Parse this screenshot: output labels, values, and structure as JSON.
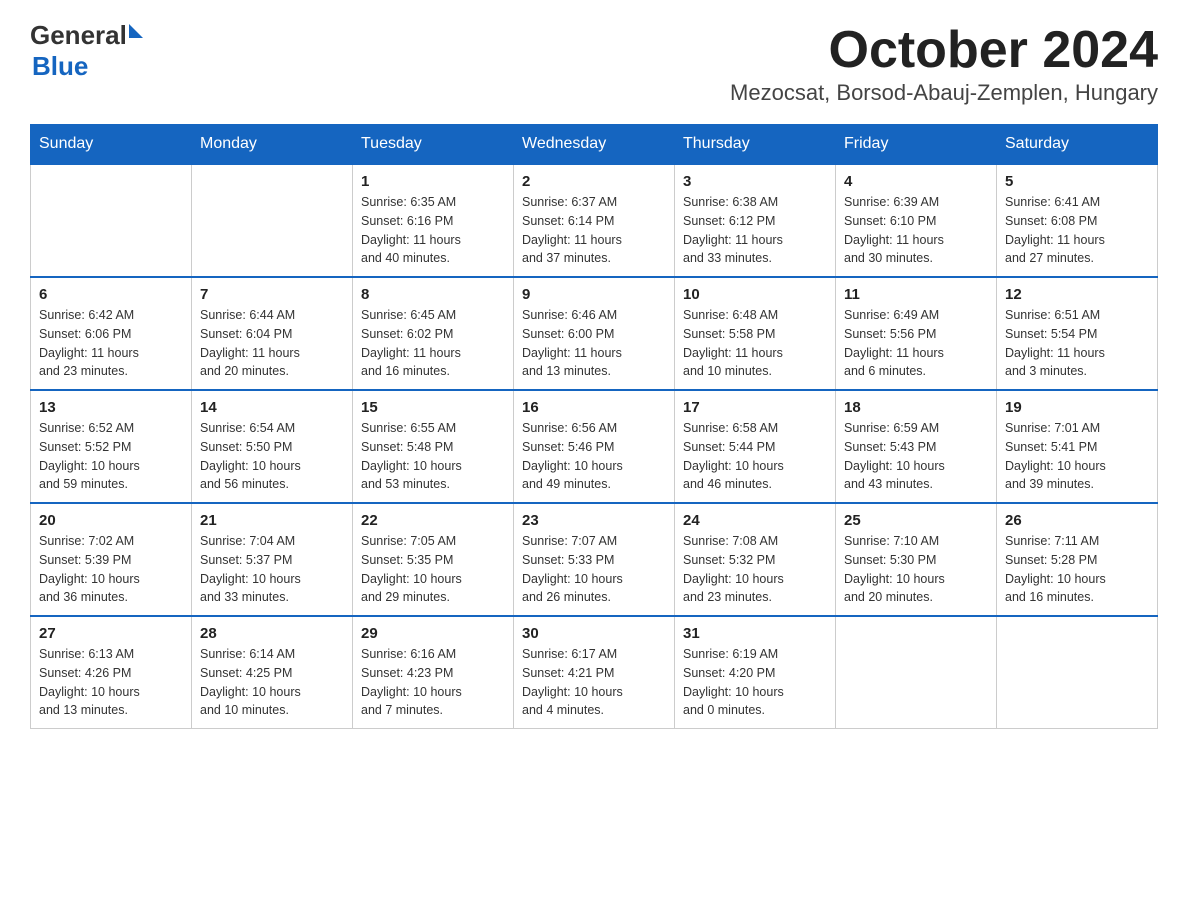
{
  "logo": {
    "general": "General",
    "blue": "Blue"
  },
  "title": "October 2024",
  "location": "Mezocsat, Borsod-Abauj-Zemplen, Hungary",
  "weekdays": [
    "Sunday",
    "Monday",
    "Tuesday",
    "Wednesday",
    "Thursday",
    "Friday",
    "Saturday"
  ],
  "weeks": [
    [
      {
        "day": "",
        "info": ""
      },
      {
        "day": "",
        "info": ""
      },
      {
        "day": "1",
        "info": "Sunrise: 6:35 AM\nSunset: 6:16 PM\nDaylight: 11 hours\nand 40 minutes."
      },
      {
        "day": "2",
        "info": "Sunrise: 6:37 AM\nSunset: 6:14 PM\nDaylight: 11 hours\nand 37 minutes."
      },
      {
        "day": "3",
        "info": "Sunrise: 6:38 AM\nSunset: 6:12 PM\nDaylight: 11 hours\nand 33 minutes."
      },
      {
        "day": "4",
        "info": "Sunrise: 6:39 AM\nSunset: 6:10 PM\nDaylight: 11 hours\nand 30 minutes."
      },
      {
        "day": "5",
        "info": "Sunrise: 6:41 AM\nSunset: 6:08 PM\nDaylight: 11 hours\nand 27 minutes."
      }
    ],
    [
      {
        "day": "6",
        "info": "Sunrise: 6:42 AM\nSunset: 6:06 PM\nDaylight: 11 hours\nand 23 minutes."
      },
      {
        "day": "7",
        "info": "Sunrise: 6:44 AM\nSunset: 6:04 PM\nDaylight: 11 hours\nand 20 minutes."
      },
      {
        "day": "8",
        "info": "Sunrise: 6:45 AM\nSunset: 6:02 PM\nDaylight: 11 hours\nand 16 minutes."
      },
      {
        "day": "9",
        "info": "Sunrise: 6:46 AM\nSunset: 6:00 PM\nDaylight: 11 hours\nand 13 minutes."
      },
      {
        "day": "10",
        "info": "Sunrise: 6:48 AM\nSunset: 5:58 PM\nDaylight: 11 hours\nand 10 minutes."
      },
      {
        "day": "11",
        "info": "Sunrise: 6:49 AM\nSunset: 5:56 PM\nDaylight: 11 hours\nand 6 minutes."
      },
      {
        "day": "12",
        "info": "Sunrise: 6:51 AM\nSunset: 5:54 PM\nDaylight: 11 hours\nand 3 minutes."
      }
    ],
    [
      {
        "day": "13",
        "info": "Sunrise: 6:52 AM\nSunset: 5:52 PM\nDaylight: 10 hours\nand 59 minutes."
      },
      {
        "day": "14",
        "info": "Sunrise: 6:54 AM\nSunset: 5:50 PM\nDaylight: 10 hours\nand 56 minutes."
      },
      {
        "day": "15",
        "info": "Sunrise: 6:55 AM\nSunset: 5:48 PM\nDaylight: 10 hours\nand 53 minutes."
      },
      {
        "day": "16",
        "info": "Sunrise: 6:56 AM\nSunset: 5:46 PM\nDaylight: 10 hours\nand 49 minutes."
      },
      {
        "day": "17",
        "info": "Sunrise: 6:58 AM\nSunset: 5:44 PM\nDaylight: 10 hours\nand 46 minutes."
      },
      {
        "day": "18",
        "info": "Sunrise: 6:59 AM\nSunset: 5:43 PM\nDaylight: 10 hours\nand 43 minutes."
      },
      {
        "day": "19",
        "info": "Sunrise: 7:01 AM\nSunset: 5:41 PM\nDaylight: 10 hours\nand 39 minutes."
      }
    ],
    [
      {
        "day": "20",
        "info": "Sunrise: 7:02 AM\nSunset: 5:39 PM\nDaylight: 10 hours\nand 36 minutes."
      },
      {
        "day": "21",
        "info": "Sunrise: 7:04 AM\nSunset: 5:37 PM\nDaylight: 10 hours\nand 33 minutes."
      },
      {
        "day": "22",
        "info": "Sunrise: 7:05 AM\nSunset: 5:35 PM\nDaylight: 10 hours\nand 29 minutes."
      },
      {
        "day": "23",
        "info": "Sunrise: 7:07 AM\nSunset: 5:33 PM\nDaylight: 10 hours\nand 26 minutes."
      },
      {
        "day": "24",
        "info": "Sunrise: 7:08 AM\nSunset: 5:32 PM\nDaylight: 10 hours\nand 23 minutes."
      },
      {
        "day": "25",
        "info": "Sunrise: 7:10 AM\nSunset: 5:30 PM\nDaylight: 10 hours\nand 20 minutes."
      },
      {
        "day": "26",
        "info": "Sunrise: 7:11 AM\nSunset: 5:28 PM\nDaylight: 10 hours\nand 16 minutes."
      }
    ],
    [
      {
        "day": "27",
        "info": "Sunrise: 6:13 AM\nSunset: 4:26 PM\nDaylight: 10 hours\nand 13 minutes."
      },
      {
        "day": "28",
        "info": "Sunrise: 6:14 AM\nSunset: 4:25 PM\nDaylight: 10 hours\nand 10 minutes."
      },
      {
        "day": "29",
        "info": "Sunrise: 6:16 AM\nSunset: 4:23 PM\nDaylight: 10 hours\nand 7 minutes."
      },
      {
        "day": "30",
        "info": "Sunrise: 6:17 AM\nSunset: 4:21 PM\nDaylight: 10 hours\nand 4 minutes."
      },
      {
        "day": "31",
        "info": "Sunrise: 6:19 AM\nSunset: 4:20 PM\nDaylight: 10 hours\nand 0 minutes."
      },
      {
        "day": "",
        "info": ""
      },
      {
        "day": "",
        "info": ""
      }
    ]
  ]
}
